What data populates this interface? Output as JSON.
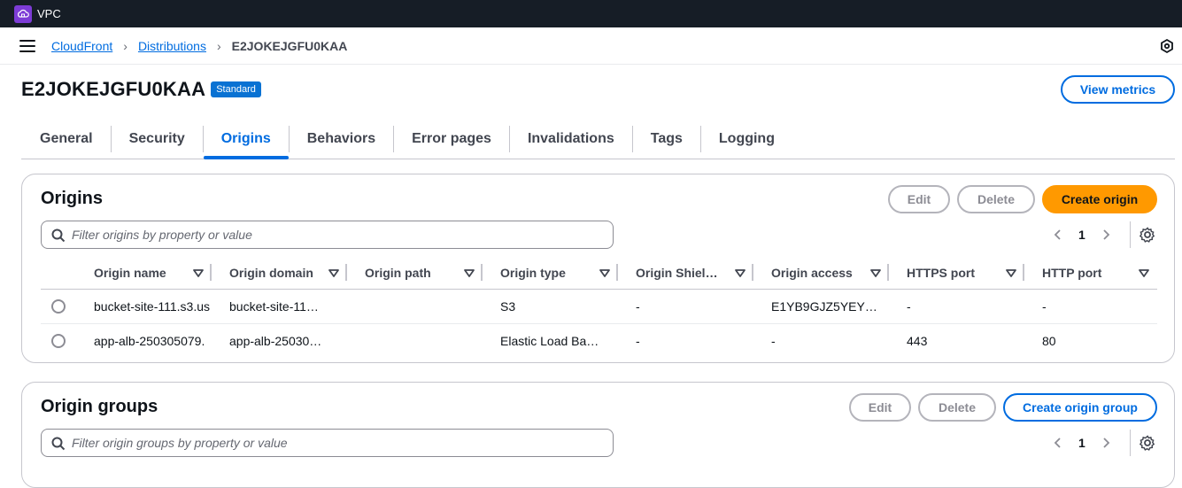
{
  "topbar": {
    "service_label": "VPC",
    "service_icon": "vpc-icon"
  },
  "breadcrumb": {
    "items": [
      "CloudFront",
      "Distributions"
    ],
    "current": "E2JOKEJGFU0KAA"
  },
  "header": {
    "title": "E2JOKEJGFU0KAA",
    "badge": "Standard",
    "view_metrics_label": "View metrics"
  },
  "tabs": [
    "General",
    "Security",
    "Origins",
    "Behaviors",
    "Error pages",
    "Invalidations",
    "Tags",
    "Logging"
  ],
  "active_tab": "Origins",
  "origins": {
    "title": "Origins",
    "edit_label": "Edit",
    "delete_label": "Delete",
    "create_label": "Create origin",
    "filter_placeholder": "Filter origins by property or value",
    "page": "1",
    "columns": [
      "Origin name",
      "Origin domain",
      "Origin path",
      "Origin type",
      "Origin Shiel…",
      "Origin access",
      "HTTPS port",
      "HTTP port"
    ],
    "rows": [
      [
        "bucket-site-111.s3.us",
        "bucket-site-11…",
        "",
        "S3",
        "-",
        "E1YB9GJZ5YEY…",
        "-",
        "-"
      ],
      [
        "app-alb-250305079.",
        "app-alb-25030…",
        "",
        "Elastic Load Ba…",
        "-",
        "-",
        "443",
        "80"
      ]
    ]
  },
  "origin_groups": {
    "title": "Origin groups",
    "edit_label": "Edit",
    "delete_label": "Delete",
    "create_label": "Create origin group",
    "filter_placeholder": "Filter origin groups by property or value",
    "page": "1"
  },
  "colors": {
    "accent": "#006ce0",
    "primary_button": "#ff9900",
    "topbar": "#161d26",
    "badge": "#0972d3"
  }
}
